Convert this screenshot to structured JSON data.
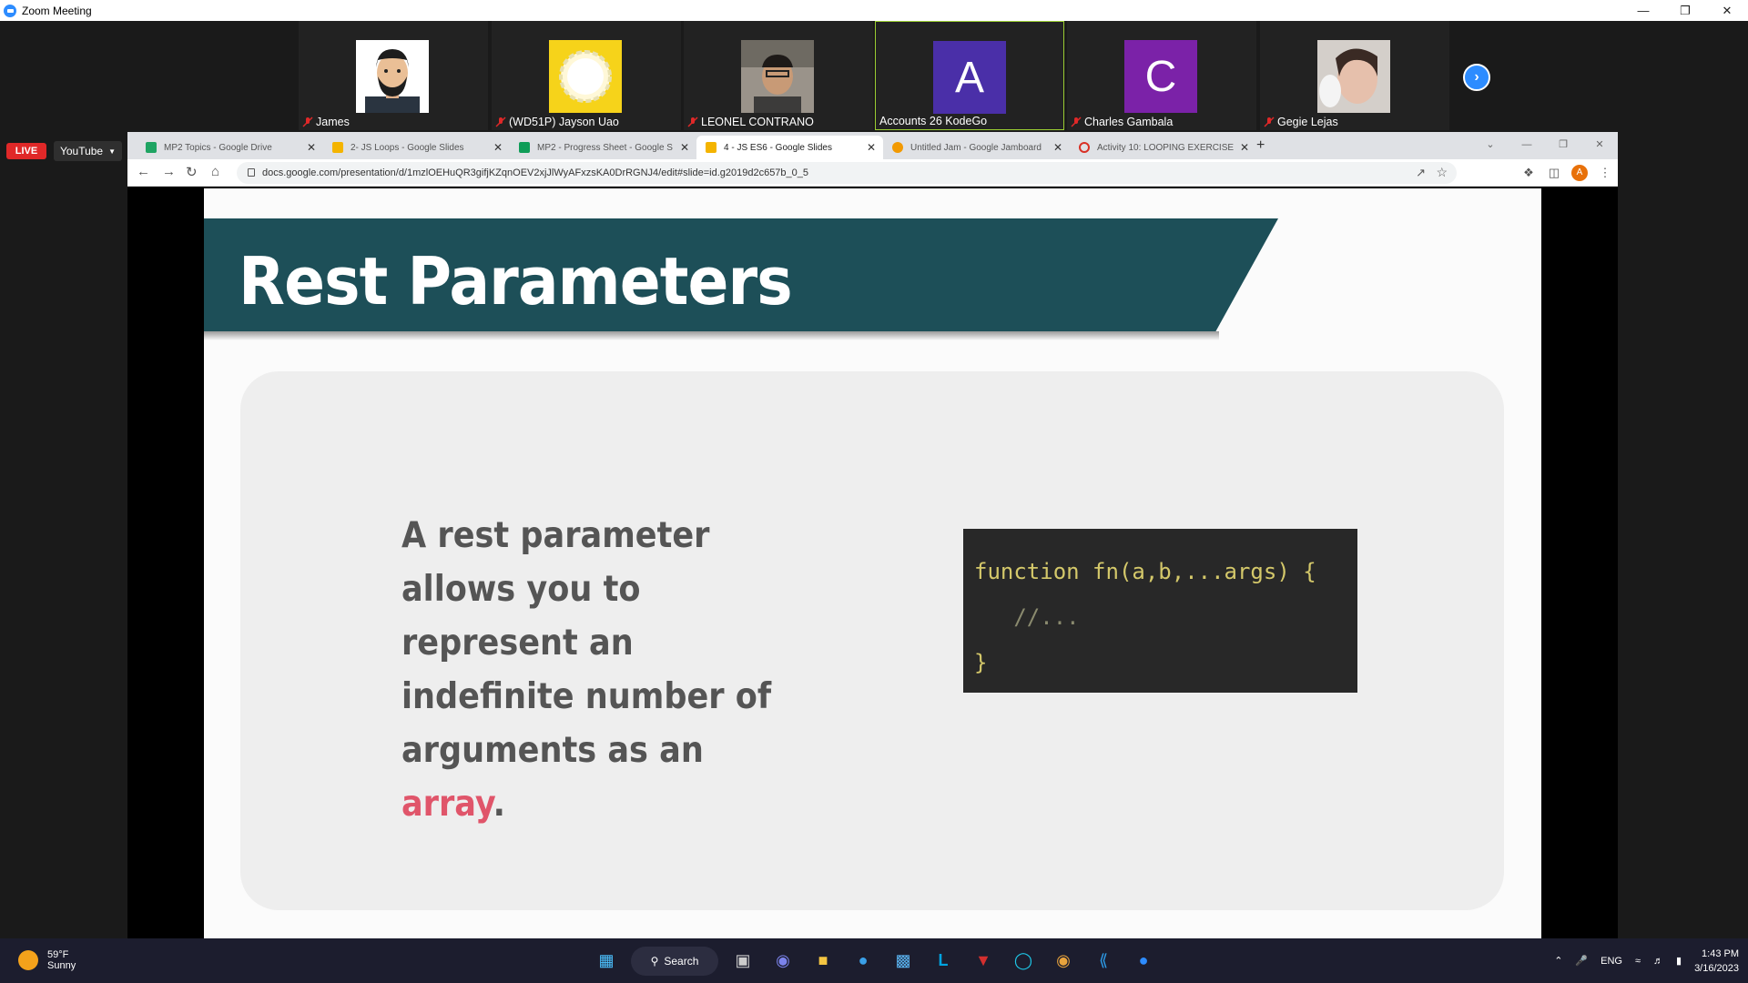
{
  "window": {
    "title": "Zoom Meeting",
    "accent": "#2d8cff"
  },
  "participants": [
    {
      "name": "James",
      "avatar_type": "cartoon-photo",
      "muted": true,
      "active": false
    },
    {
      "name": "(WD51P) Jayson Uao",
      "avatar_type": "flower-photo",
      "muted": true,
      "active": false
    },
    {
      "name": "LEONEL CONTRANO",
      "avatar_type": "person-photo",
      "muted": true,
      "active": false
    },
    {
      "name": "Accounts 26 KodeGo",
      "initial": "A",
      "color": "#4a2fa8",
      "muted": false,
      "active": true
    },
    {
      "name": "Charles Gambala",
      "initial": "C",
      "color": "#7b22a8",
      "muted": true,
      "active": false
    },
    {
      "name": "Gegie Lejas",
      "avatar_type": "person-photo",
      "muted": true,
      "active": false
    }
  ],
  "stream": {
    "live_label": "LIVE",
    "platform": "YouTube"
  },
  "browser": {
    "tabs": [
      {
        "title": "MP2 Topics - Google Drive",
        "color": "#1fa463",
        "active": false
      },
      {
        "title": "2- JS Loops - Google Slides",
        "color": "#f4b400",
        "active": false
      },
      {
        "title": "MP2 - Progress Sheet - Google S",
        "color": "#0f9d58",
        "active": false
      },
      {
        "title": "4 - JS ES6 - Google Slides",
        "color": "#f4b400",
        "active": true
      },
      {
        "title": "Untitled Jam - Google Jamboard",
        "color": "#f29900",
        "active": false
      },
      {
        "title": "Activity 10: LOOPING EXERCISE",
        "color": "#d93025",
        "active": false
      }
    ],
    "url": "docs.google.com/presentation/d/1mzlOEHuQR3gifjKZqnOEV2xjJlWyAFxzsKA0DrRGNJ4/edit#slide=id.g2019d2c657b_0_5",
    "profile_initial": "A"
  },
  "slide": {
    "title": "Rest Parameters",
    "desc_before": "A rest parameter allows you to represent an indefinite number of arguments as an ",
    "desc_highlight": "array",
    "desc_after": ".",
    "code_lines": [
      "function fn(a,b,...args) {",
      "   //...",
      "}"
    ],
    "banner_color": "#1d4f58",
    "highlight_color": "#e0556a"
  },
  "taskbar": {
    "weather_temp": "59°F",
    "weather_desc": "Sunny",
    "search_label": "Search",
    "lang": "ENG",
    "time": "1:43 PM",
    "date": "3/16/2023"
  }
}
